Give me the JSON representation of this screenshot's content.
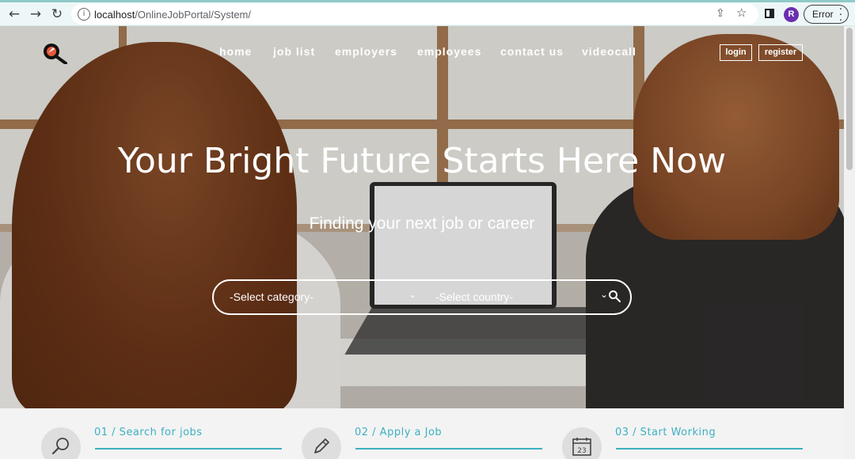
{
  "browser": {
    "url_host": "localhost",
    "url_path": "/OnlineJobPortal/System/",
    "profile_initial": "R",
    "status_label": "Error",
    "icons": [
      "back-icon",
      "forward-icon",
      "reload-icon",
      "info-icon",
      "share-icon",
      "star-icon",
      "side-panel-icon",
      "menu-dots-icon"
    ]
  },
  "nav": {
    "items": [
      "home",
      "job list",
      "employers",
      "employees",
      "contact us",
      "videocall"
    ],
    "login_label": "login",
    "register_label": "register"
  },
  "hero": {
    "headline": "Your Bright Future Starts Here Now",
    "subline": "Finding your next job or career",
    "category_select": "-Select category-",
    "country_select": "-Select country-"
  },
  "steps": [
    {
      "title": "01 / Search for jobs",
      "icon": "search-icon"
    },
    {
      "title": "02 / Apply a Job",
      "icon": "pencil-icon"
    },
    {
      "title": "03 / Start Working",
      "icon": "calendar-icon",
      "icon_text": "23"
    }
  ],
  "colors": {
    "accent": "#3eb0c2",
    "chrome_bg": "#eef7f7",
    "avatar": "#6a2fb0"
  }
}
